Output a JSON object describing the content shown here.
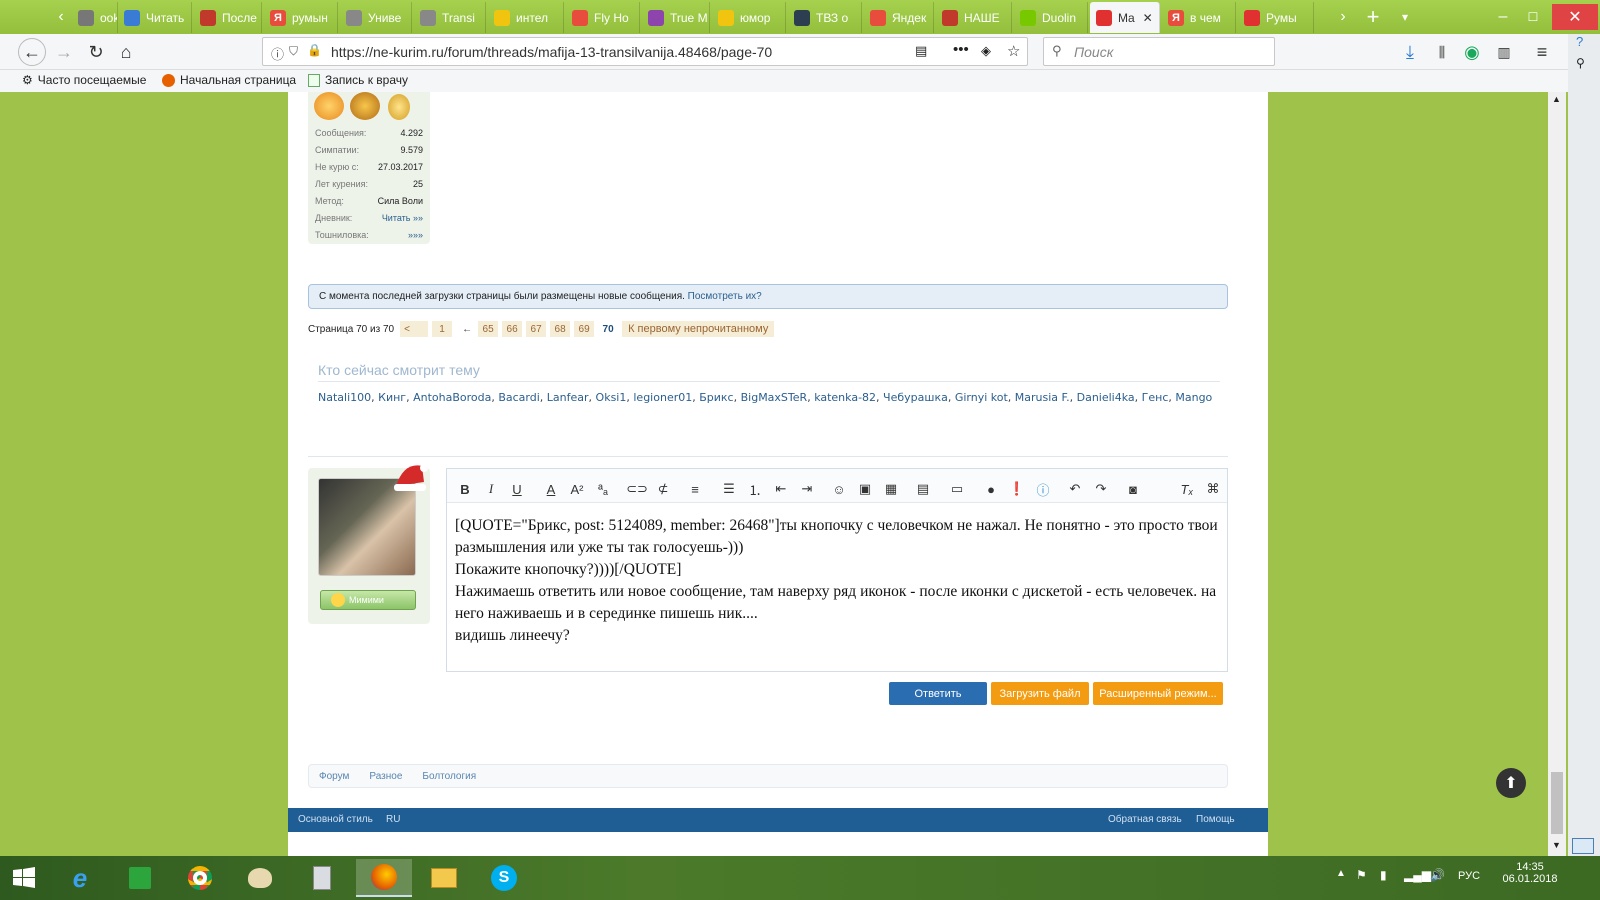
{
  "tabs": [
    {
      "label": "ooks",
      "favicon_color": "#777"
    },
    {
      "label": "Читать",
      "favicon_color": "#3a7bd5"
    },
    {
      "label": "После",
      "favicon_color": "#c0392b"
    },
    {
      "label": "румын",
      "favicon_color": "#e74c3c",
      "favicon_glyph": "Я"
    },
    {
      "label": "Униве",
      "favicon_color": "#888"
    },
    {
      "label": "Transi",
      "favicon_color": "#888"
    },
    {
      "label": "интел",
      "favicon_color": "#f1c40f"
    },
    {
      "label": "Fly Ho",
      "favicon_color": "#e74c3c"
    },
    {
      "label": "True M",
      "favicon_color": "#8e44ad"
    },
    {
      "label": "юмор",
      "favicon_color": "#f1c40f"
    },
    {
      "label": "ТВЗ о",
      "favicon_color": "#2c3e50"
    },
    {
      "label": "Яндек",
      "favicon_color": "#e74c3c"
    },
    {
      "label": "НАШЕ",
      "favicon_color": "#c0392b"
    },
    {
      "label": "Duolin",
      "favicon_color": "#78c800"
    },
    {
      "label": "Ma",
      "favicon_color": "#e03030",
      "active": true
    },
    {
      "label": "в чем",
      "favicon_color": "#e74c3c",
      "favicon_glyph": "Я"
    },
    {
      "label": "Румы",
      "favicon_color": "#e03030"
    }
  ],
  "browser": {
    "url": "https://ne-kurim.ru/forum/threads/mafija-13-transilvanija.48468/page-70",
    "search_placeholder": "Поиск"
  },
  "bookmarks": [
    {
      "label": "Часто посещаемые",
      "icon": "gear-icon"
    },
    {
      "label": "Начальная страница",
      "icon": "firefox-icon"
    },
    {
      "label": "Запись к врачу",
      "icon": "page-icon"
    }
  ],
  "user_stats": [
    {
      "label": "Сообщения:",
      "value": "4.292"
    },
    {
      "label": "Симпатии:",
      "value": "9.579"
    },
    {
      "label": "Не курю с:",
      "value": "27.03.2017"
    },
    {
      "label": "Лет курения:",
      "value": "25"
    },
    {
      "label": "Метод:",
      "value": "Сила Воли"
    },
    {
      "label": "Дневник:",
      "value": "Читать »»"
    },
    {
      "label": "Тошниловка:",
      "value": "»»»"
    }
  ],
  "notice": {
    "text": "С момента последней загрузки страницы были размещены новые сообщения.",
    "link": "Посмотреть их?"
  },
  "pagination": {
    "label": "Страница 70 из 70",
    "prev": "<",
    "first": "1",
    "ellipsis": "←",
    "pages": [
      "65",
      "66",
      "67",
      "68",
      "69"
    ],
    "current": "70",
    "first_unread": "К первому непрочитанному"
  },
  "viewers": {
    "title": "Кто сейчас смотрит тему",
    "names": [
      "Natali100",
      "Кинг",
      "AntohaBoroda",
      "Bacardi",
      "Lanfear",
      "Oksi1",
      "legioner01",
      "Брикс",
      "BigMaxSTeR",
      "katenka-82",
      "Чебурашка",
      "Girnyi kot",
      "Marusia F.",
      "Danieli4ka",
      "Генс",
      "Mango"
    ]
  },
  "editor": {
    "avatar_badge": "Мимими",
    "lines": [
      "[QUOTE=\"Брикс, post: 5124089, member: 26468\"]ты кнопочку с человечком не нажал. Не понятно - это просто твои размышления или уже ты так голосуешь-)))",
      "Покажите кнопочку?))))[/QUOTE]",
      "Нажимаешь ответить или новое сообщение, там наверху ряд иконок - после иконки с дискетой - есть человечек. на него наживаешь и в серединке пишешь ник....",
      "видишь линеечу?"
    ],
    "reply_button": "Ответить",
    "upload_button": "Загрузить файл",
    "advanced_button": "Расширенный режим...",
    "colors": {
      "reply": "#2a6db0",
      "upload": "#f39c12",
      "advanced": "#f39c12"
    }
  },
  "breadcrumbs": [
    "Форум",
    "Разное",
    "Болтология"
  ],
  "footer": {
    "style": "Основной стиль",
    "lang": "RU",
    "feedback": "Обратная связь",
    "help": "Помощь"
  },
  "system": {
    "lang": "РУС",
    "time": "14:35",
    "date": "06.01.2018"
  }
}
